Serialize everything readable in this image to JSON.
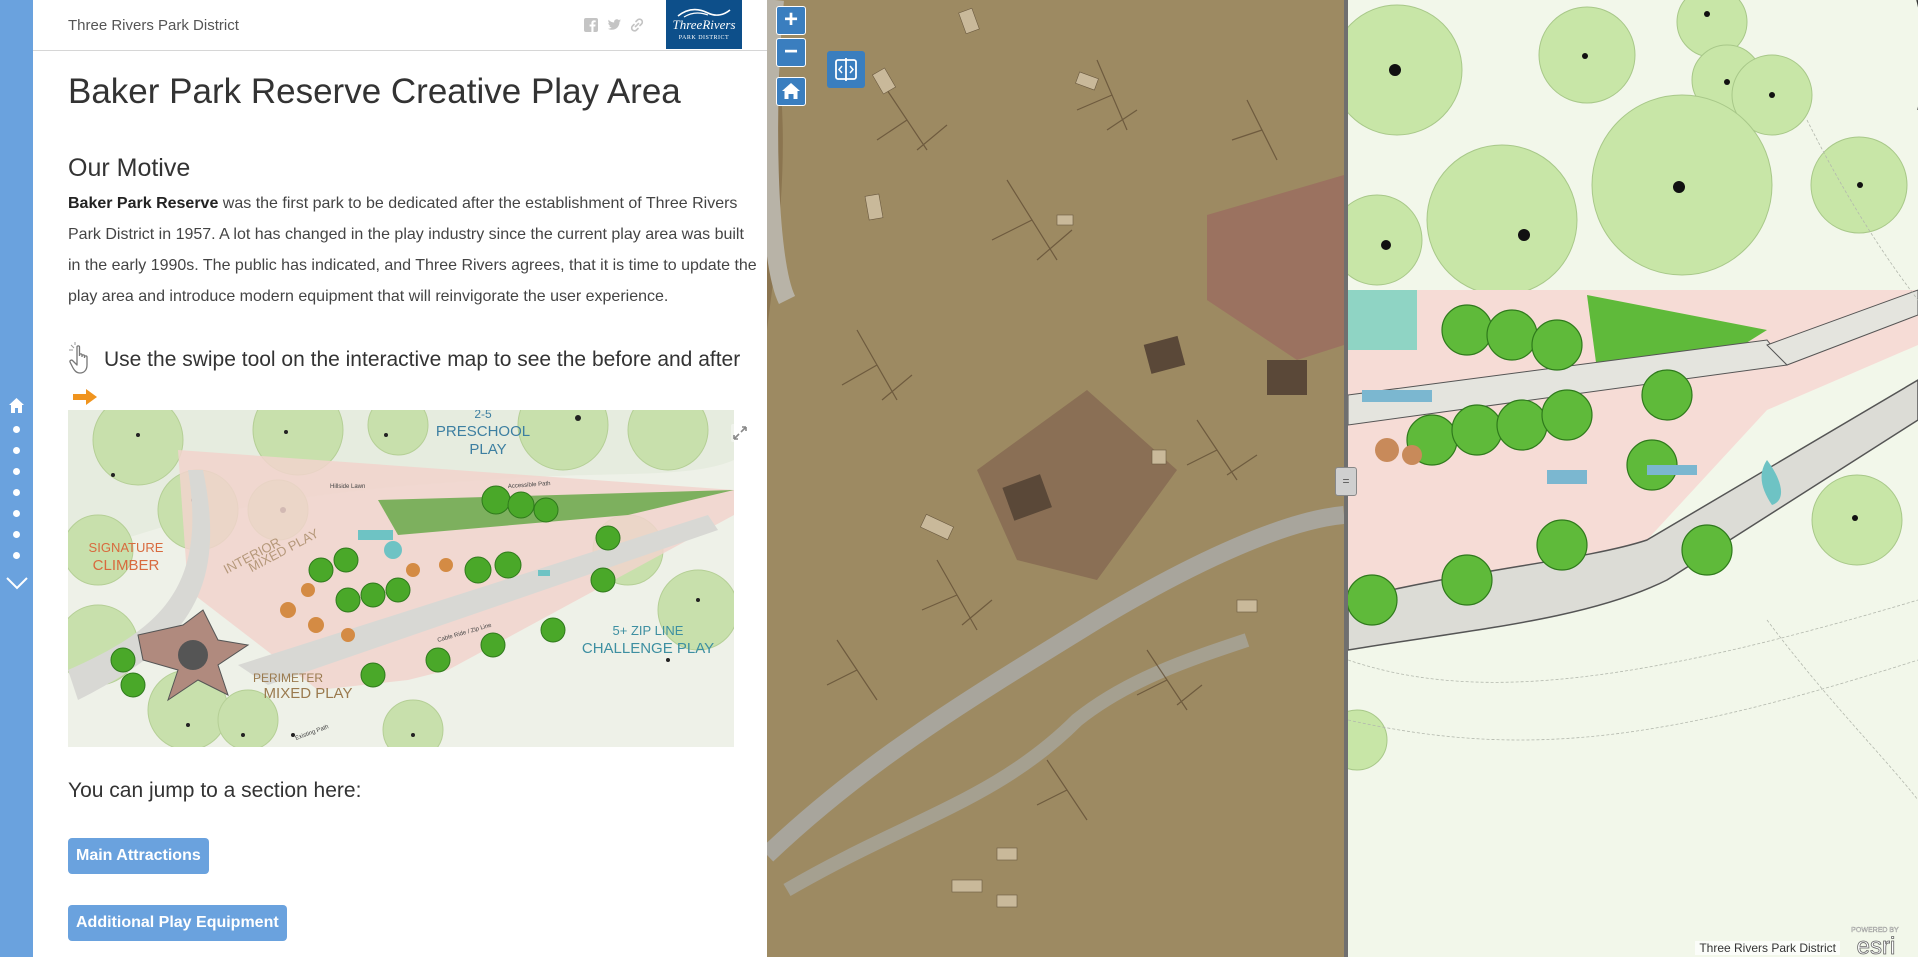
{
  "colors": {
    "accent": "#6aa2de",
    "brand_navy": "#0d4f8a",
    "map_button": "#3a7ebf",
    "orange": "#f0941e"
  },
  "header": {
    "title": "Three Rivers Park District",
    "share_icons": [
      "facebook-icon",
      "twitter-icon",
      "link-icon"
    ],
    "logo": {
      "name": "ThreeRivers",
      "sub": "PARK DISTRICT"
    }
  },
  "nav": {
    "section_dots": 7
  },
  "content": {
    "page_title": "Baker Park Reserve Creative Play Area",
    "motive_heading": "Our Motive",
    "motive_bold": "Baker Park Reserve",
    "motive_text": " was the first park to be dedicated after the establishment of Three Rivers Park District in 1957. A lot has changed in the play industry since the current play area was built in the early 1990s. The public has indicated, and Three Rivers agrees, that it is time to update the play area and introduce modern equipment that will reinvigorate the user experience.",
    "swipe_instruction": "Use the swipe tool on the interactive map to see the before and after",
    "jump_text": "You can jump to a section here:",
    "buttons": [
      "Main Attractions",
      "Additional Play Equipment"
    ]
  },
  "plan_labels": {
    "preschool_ages": "2-5",
    "preschool_title": "PRESCHOOL",
    "preschool_sub": "PLAY",
    "signature": "SIGNATURE",
    "climber": "CLIMBER",
    "perimeter": "PERIMETER",
    "mixed_play": "MIXED PLAY",
    "interior": "INTERIOR",
    "interior_mixed": "MIXED PLAY",
    "zipline": "5+ ZIP LINE",
    "challenge": "CHALLENGE PLAY",
    "hillside_lawn": "Hillside Lawn",
    "accessible_path": "Accessible Path",
    "cable_ride": "Cable Ride / Zip Line",
    "existing_path": "Existing Path"
  },
  "map": {
    "zoom_in": "+",
    "zoom_out": "−",
    "divider_handle": "=",
    "attribution": "Three Rivers Park District",
    "esri_powered": "POWERED BY",
    "esri_word": "esri"
  }
}
